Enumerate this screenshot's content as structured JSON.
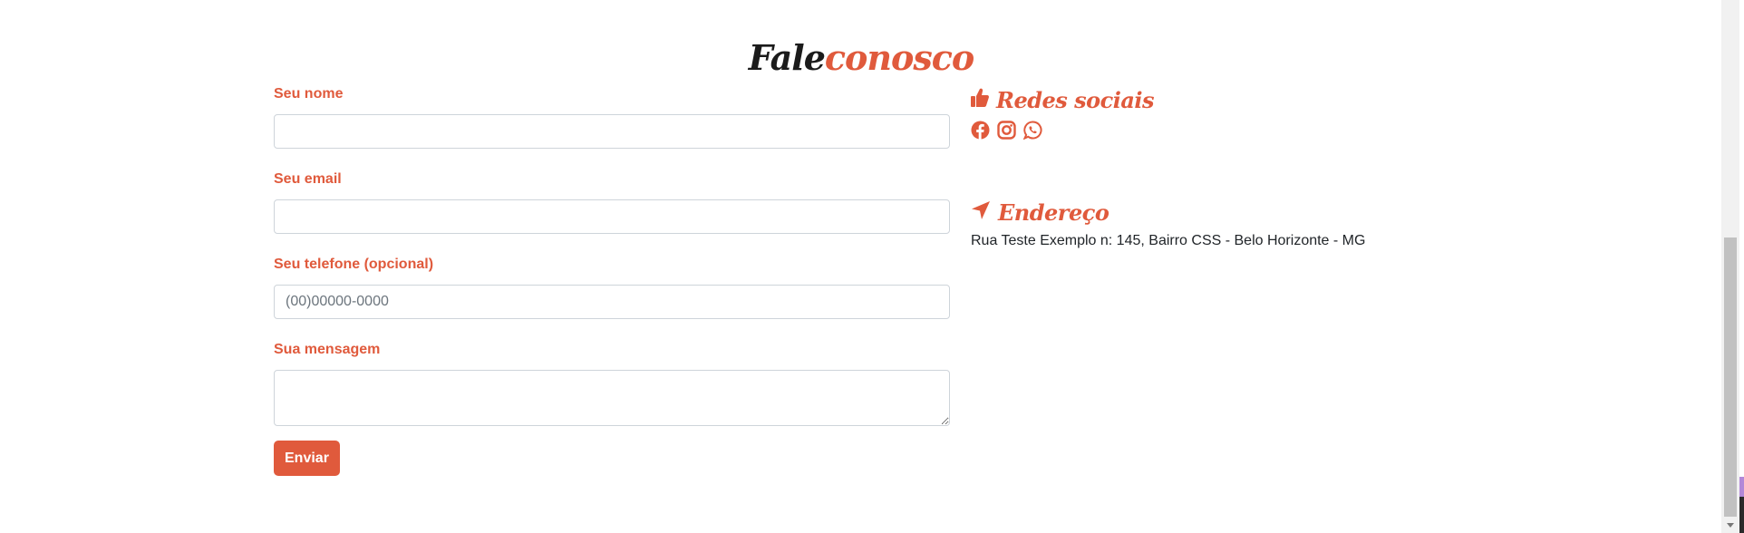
{
  "title": {
    "part1": "Fale",
    "part2": "conosco"
  },
  "form": {
    "name_label": "Seu nome",
    "name_value": "",
    "email_label": "Seu email",
    "email_value": "",
    "phone_label": "Seu telefone (opcional)",
    "phone_placeholder": "(00)00000-0000",
    "message_label": "Sua mensagem",
    "message_value": "",
    "submit_label": "Enviar"
  },
  "social": {
    "heading": "Redes sociais",
    "heading_icon": "thumbs-up-icon",
    "icons": [
      "facebook-icon",
      "instagram-icon",
      "whatsapp-icon"
    ]
  },
  "address": {
    "heading": "Endereço",
    "heading_icon": "location-arrow-icon",
    "text": "Rua Teste Exemplo n: 145, Bairro CSS - Belo Horizonte - MG"
  },
  "colors": {
    "accent": "#e05a3c",
    "dark": "#1b1b1b",
    "border": "#ced4da"
  }
}
